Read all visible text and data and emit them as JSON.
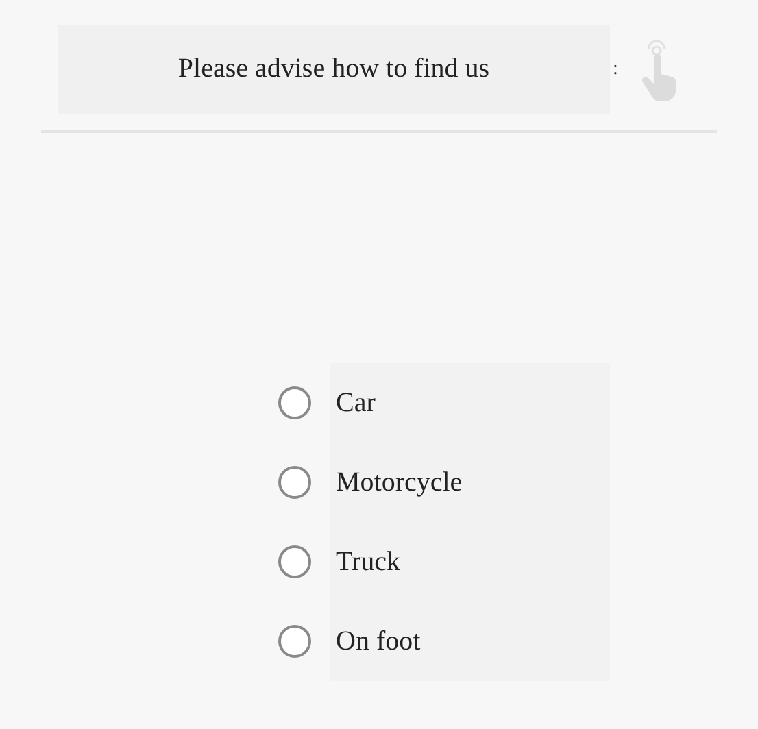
{
  "header": {
    "title": "Please advise how to find us",
    "trailing_text": ":"
  },
  "options": [
    {
      "label": "Car",
      "selected": false
    },
    {
      "label": "Motorcycle",
      "selected": false
    },
    {
      "label": "Truck",
      "selected": false
    },
    {
      "label": "On foot",
      "selected": false
    }
  ]
}
